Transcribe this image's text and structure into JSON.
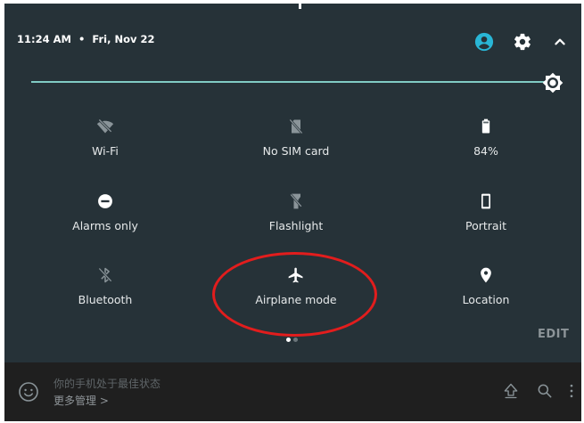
{
  "status": {
    "time": "11:24 AM",
    "separator": "•",
    "date": "Fri, Nov 22"
  },
  "header_icons": [
    "account-icon",
    "gear-icon",
    "chevron-up-icon"
  ],
  "brightness": {
    "icon": "brightness-icon",
    "level": 1.0
  },
  "tiles": [
    {
      "label": "Wi-Fi",
      "icon": "wifi-off-icon",
      "state": "off"
    },
    {
      "label": "No SIM card",
      "icon": "no-sim-icon",
      "state": "off"
    },
    {
      "label": "84%",
      "icon": "battery-icon",
      "state": "on"
    },
    {
      "label": "Alarms only",
      "icon": "do-not-disturb-icon",
      "state": "on"
    },
    {
      "label": "Flashlight",
      "icon": "flashlight-icon",
      "state": "off"
    },
    {
      "label": "Portrait",
      "icon": "portrait-icon",
      "state": "on"
    },
    {
      "label": "Bluetooth",
      "icon": "bluetooth-off-icon",
      "state": "off"
    },
    {
      "label": "Airplane mode",
      "icon": "airplane-icon",
      "state": "on"
    },
    {
      "label": "Location",
      "icon": "location-pin-icon",
      "state": "on"
    }
  ],
  "pager": {
    "pages": 2,
    "current": 1
  },
  "edit_label": "EDIT",
  "notification": {
    "title": "你的手机处于最佳状态",
    "link": "更多管理 >"
  },
  "colors": {
    "shade_bg": "#263238",
    "accent": "#29b6d6",
    "slider": "#80cbc4",
    "annotation": "#e21d1d",
    "bottom_bar": "#1f1f1f"
  }
}
